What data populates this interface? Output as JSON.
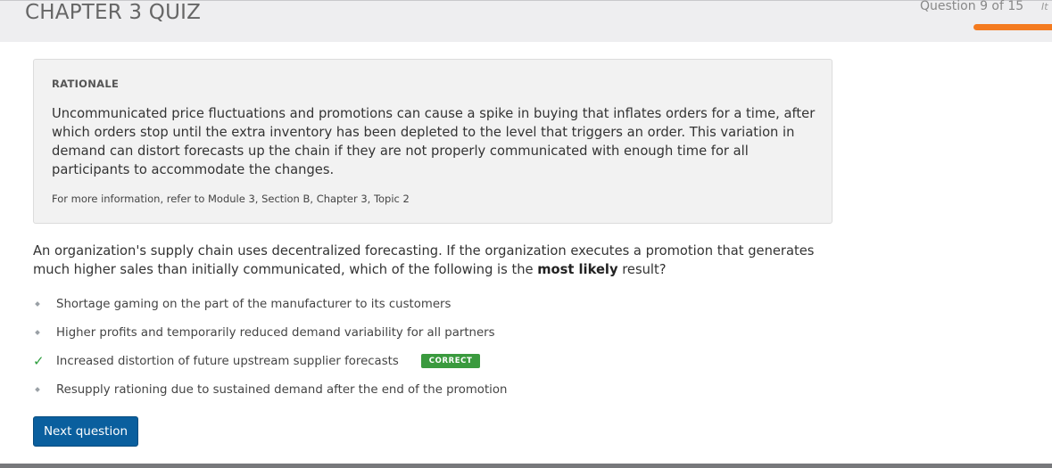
{
  "header": {
    "quiz_title": "CHAPTER 3 QUIZ",
    "question_counter": "Question 9 of 15",
    "counter_overflow": "It",
    "progress_color": "#f47b20"
  },
  "rationale": {
    "heading": "RATIONALE",
    "text": "Uncommunicated price fluctuations and promotions can cause a spike in buying that inflates orders for a time, after which orders stop until the extra inventory has been depleted to the level that triggers an order. This variation in demand can distort forecasts up the chain if they are not properly communicated with enough time for all participants to accommodate the changes.",
    "reference": "For more information, refer to Module 3, Section B, Chapter 3, Topic 2"
  },
  "question": {
    "text_before": "An organization's supply chain uses decentralized forecasting. If the organization executes a promotion that generates much higher sales than initially communicated, which of the following is the ",
    "emphasis": "most likely",
    "text_after": " result?"
  },
  "answers": [
    {
      "label": "Shortage gaming on the part of the manufacturer to its customers",
      "icon": "diamond-bullet-icon"
    },
    {
      "label": "Higher profits and temporarily reduced demand variability for all partners",
      "icon": "diamond-bullet-icon"
    },
    {
      "label": "Increased distortion of future upstream supplier forecasts",
      "icon": "check-icon",
      "badge": "CORRECT"
    },
    {
      "label": "Resupply rationing due to sustained demand after the end of the promotion",
      "icon": "diamond-bullet-icon"
    }
  ],
  "next_button": {
    "label": "Next question",
    "color": "#0a5f9e"
  }
}
